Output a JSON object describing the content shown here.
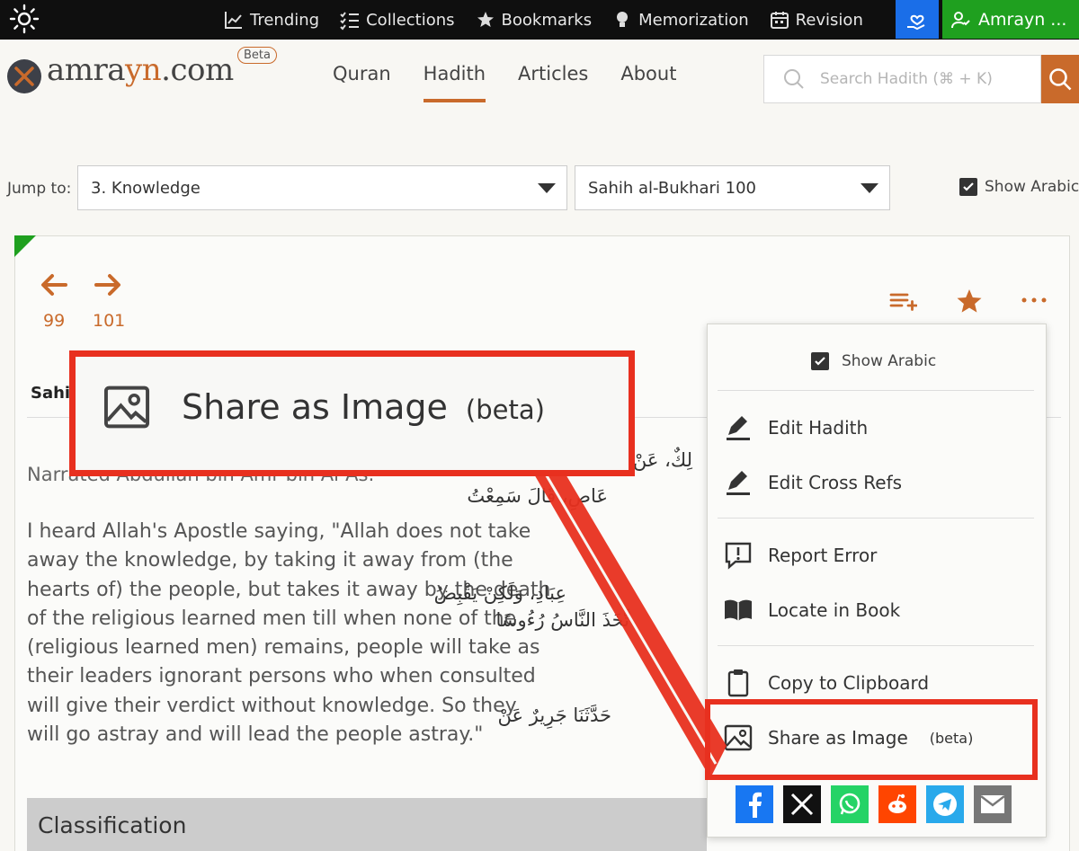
{
  "topbar": {
    "nav": [
      {
        "label": "Trending",
        "icon": "chart-line-icon"
      },
      {
        "label": "Collections",
        "icon": "checklist-icon"
      },
      {
        "label": "Bookmarks",
        "icon": "stars-icon"
      },
      {
        "label": "Memorization",
        "icon": "lightbulb-icon"
      },
      {
        "label": "Revision",
        "icon": "calendar-icon"
      }
    ],
    "user_label": "Amrayn ..."
  },
  "brand": {
    "name_a": "amra",
    "name_b": "yn",
    "name_c": ".com",
    "beta": "Beta"
  },
  "mainnav": [
    "Quran",
    "Hadith",
    "Articles",
    "About"
  ],
  "search": {
    "placeholder": "Search Hadith (⌘ + K)"
  },
  "jump": {
    "label": "Jump to:",
    "chapter": "3. Knowledge",
    "hadith": "Sahih al-Bukhari 100",
    "show_arabic": "Show Arabic"
  },
  "hadith": {
    "prev": "99",
    "next": "101",
    "tab_partial": "Sahi",
    "narrated_partial": "Narrated Abdullah bin Amr bin Al-As:",
    "text": "I heard Allah's Apostle saying, \"Allah does not take away the knowledge, by taking it away from (the hearts of) the people, but takes it away by the death of the religious learned men till when none of the (religious learned men) remains, people will take as their leaders ignorant persons who when consulted will give their verdict without knowledge. So they will go astray and will lead the people astray.\"",
    "arabic_lines": [
      "لِكٌ، عَنْ",
      "عَاصِ، قَالَ سَمِعْتُ",
      "عِبَادِ، وَلَكِنْ يَقْبِضُ",
      "تَّخَذَ النَّاسُ رُءُوسًا",
      "حَدَّثَنَا جَرِيرٌ عَنْ"
    ],
    "classification": "Classification"
  },
  "menu": {
    "show_arabic": "Show Arabic",
    "items": [
      {
        "label": "Edit Hadith",
        "icon": "pencil-icon"
      },
      {
        "label": "Edit Cross Refs",
        "icon": "pencil-icon"
      },
      {
        "label": "Report Error",
        "icon": "report-icon"
      },
      {
        "label": "Locate in Book",
        "icon": "book-icon"
      },
      {
        "label": "Copy to Clipboard",
        "icon": "clipboard-icon"
      },
      {
        "label": "Share as Image",
        "beta": "(beta)",
        "icon": "image-icon"
      }
    ],
    "share": [
      "facebook",
      "x",
      "whatsapp",
      "reddit",
      "telegram",
      "email"
    ]
  },
  "zoom": {
    "label": "Share as Image",
    "beta": "(beta)"
  },
  "colors": {
    "accent": "#c96a2b",
    "highlight": "#e8301f",
    "green": "#1fa01f",
    "blue": "#1a6ee8"
  }
}
